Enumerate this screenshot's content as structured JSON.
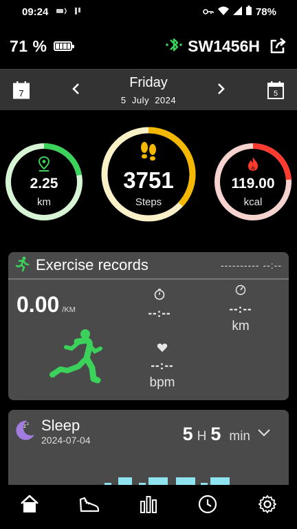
{
  "status_bar": {
    "time": "09:24",
    "battery": "78%"
  },
  "device": {
    "battery_percent": "71 %",
    "name": "SW1456H"
  },
  "date": {
    "weekday": "Friday",
    "day": "5",
    "month": "July",
    "year": "2024",
    "prev_cal_day": "7",
    "next_cal_day": "5"
  },
  "rings": {
    "distance": {
      "value": "2.25",
      "unit": "km",
      "progress": 0.22,
      "color": "#3ad25a"
    },
    "steps": {
      "value": "3751",
      "unit": "Steps",
      "progress": 0.37,
      "color": "#f5b800"
    },
    "calories": {
      "value": "119.00",
      "unit": "kcal",
      "progress": 0.24,
      "color": "#ff3b2f"
    }
  },
  "exercise": {
    "title": "Exercise records",
    "time_range": "---------- --:--",
    "pace": "0.00",
    "pace_unit": "/KM",
    "duration": "--:--",
    "distance": "--:--",
    "distance_unit": "km",
    "heart_rate": "--:--",
    "heart_rate_unit": "bpm"
  },
  "sleep": {
    "title": "Sleep",
    "date": "2024-07-04",
    "hours": "5",
    "hours_label": "H",
    "minutes": "5",
    "minutes_label": "min"
  },
  "colors": {
    "accent_green": "#3ad25a",
    "card_bg": "#4a4a4a",
    "sleep_purple": "#a27ce0",
    "sleep_bar": "#8fe3ee"
  }
}
